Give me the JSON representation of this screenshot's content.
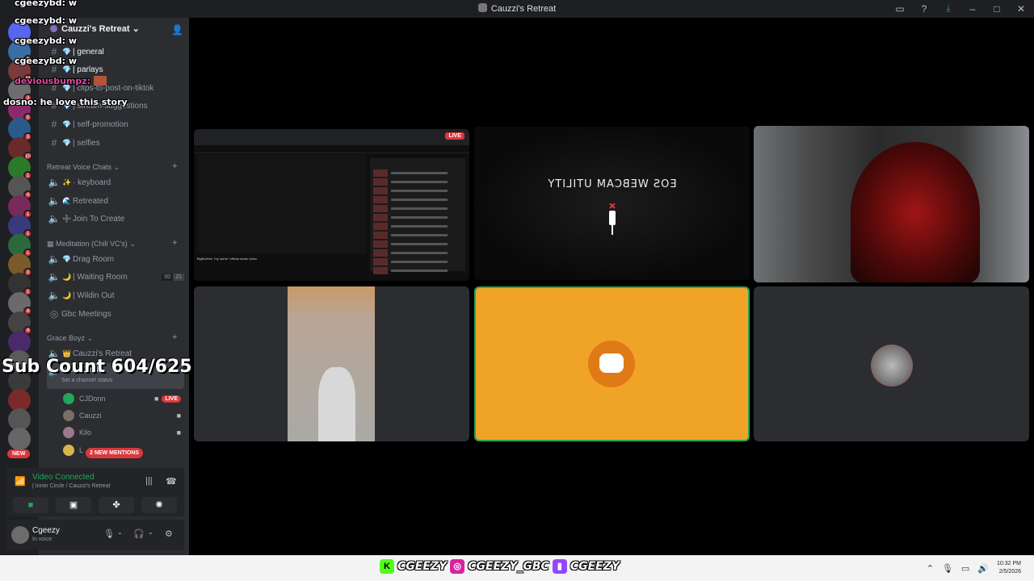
{
  "window": {
    "title": "Cauzzi's Retreat"
  },
  "titlebar_icons": [
    "inbox-icon",
    "help-icon",
    "download-icon",
    "minimize-icon",
    "maximize-icon",
    "close-icon"
  ],
  "server": {
    "name": "Cauzzi's Retreat"
  },
  "text_channels": [
    {
      "emoji": "💎",
      "name": "| general"
    },
    {
      "emoji": "💎",
      "name": "| parlays"
    },
    {
      "emoji": "💎",
      "name": "| clips-to-post-on-tiktok"
    },
    {
      "emoji": "💎",
      "name": "| stream-suggestions"
    },
    {
      "emoji": "💎",
      "name": "| self-promotion"
    },
    {
      "emoji": "💎",
      "name": "| selfies"
    }
  ],
  "categories": {
    "retreat_vc": "Retreat Voice Chats",
    "meditation": "Meditation (Chill VC's)",
    "grace": "Grace Boyz"
  },
  "retreat_voice": [
    {
      "emoji": "✨",
      "name": "· keyboard"
    },
    {
      "emoji": "🌊",
      "name": "Retreated"
    },
    {
      "emoji": "➕",
      "name": "Join To Create"
    }
  ],
  "meditation_voice": [
    {
      "emoji": "💎",
      "name": "Drag Room"
    },
    {
      "emoji": "🌙",
      "name": "| Waiting Room",
      "count_a": "00",
      "count_b": "21"
    },
    {
      "emoji": "🌙",
      "name": "| Wildin Out"
    },
    {
      "emoji": "",
      "name": "Gbc Meetings"
    }
  ],
  "grace_voice": [
    {
      "emoji": "👑",
      "name": "Cauzzi's Retreat"
    },
    {
      "emoji": "",
      "name": "Inner Circle",
      "status": "Set a channel status"
    }
  ],
  "voice_users": [
    {
      "name": "CJDonn",
      "live": "LIVE"
    },
    {
      "name": "Cauzzi",
      "live": ""
    },
    {
      "name": "Kilo",
      "live": ""
    },
    {
      "name": "L",
      "live": ""
    }
  ],
  "mentions_pill": "2 NEW MENTIONS",
  "new_pill": "NEW",
  "guild_badges": [
    "1",
    "24",
    "3",
    "5",
    "3",
    "10",
    "1",
    "4",
    "1",
    "1",
    "1",
    "3",
    "1",
    "4",
    "4"
  ],
  "voice_panel": {
    "status": "Video Connected",
    "location": "| Inner Circle / Cauzzi's Retreat"
  },
  "user_panel": {
    "name": "Cgeezy",
    "status": "In voice"
  },
  "tiles": {
    "screenshare_live": "LIVE",
    "eos_text": "EOS WEBCAM UTILITY",
    "yt_caption": "BigBoiGek \"my name\" official music video"
  },
  "chat_overlay": [
    {
      "user": "cgeezybd:",
      "msg": "w"
    },
    {
      "user": "cgeezybd:",
      "msg": "w"
    },
    {
      "user": "cgeezybd:",
      "msg": "w"
    },
    {
      "user": "deviousbumpz:",
      "msg": ""
    },
    {
      "user": "dosno:",
      "msg": "he love this story"
    }
  ],
  "sub_count": "Sub Count 604/625",
  "socials": [
    {
      "icon": "K",
      "handle": "CGEEZY"
    },
    {
      "icon": "◎",
      "handle": "CGEEZY_GBC"
    },
    {
      "icon": "▮",
      "handle": "CGEEZY"
    }
  ],
  "clock": {
    "time": "10:32 PM",
    "date": "2/5/2026"
  },
  "colors": {
    "accent_green": "#23a55a",
    "live_red": "#da373c",
    "tile_orange": "#f0a427"
  }
}
